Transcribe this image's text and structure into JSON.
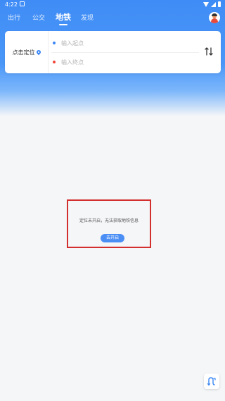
{
  "status_bar": {
    "time": "4:22"
  },
  "tabs": [
    {
      "label": "出行",
      "active": false
    },
    {
      "label": "公交",
      "active": false
    },
    {
      "label": "地铁",
      "active": true
    },
    {
      "label": "发现",
      "active": false
    }
  ],
  "route_card": {
    "locate_label": "点击定位",
    "start_placeholder": "输入起点",
    "end_placeholder": "输入终点",
    "start_dot_color": "#3a86f5",
    "end_dot_color": "#f0463c"
  },
  "empty_state": {
    "message": "定位未开启，无法获取地铁信息",
    "button_label": "去开启"
  },
  "icons": {
    "avatar": "avatar",
    "pin": "location-pin-icon",
    "swap": "swap-icon",
    "route": "route-icon"
  },
  "colors": {
    "accent": "#3a86f5",
    "highlight_border": "#d32f2f"
  }
}
